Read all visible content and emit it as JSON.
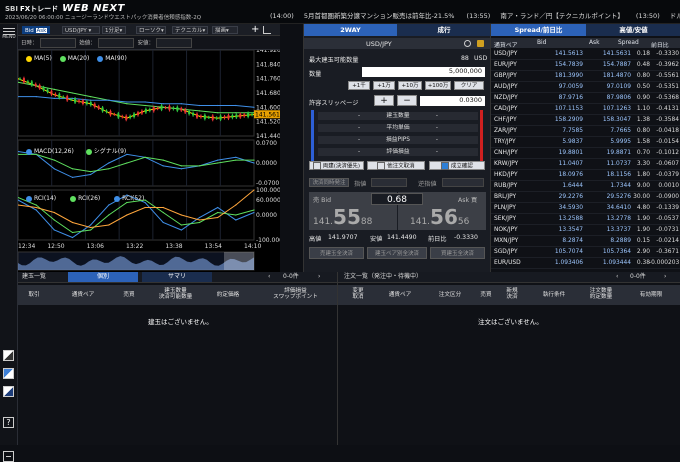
{
  "app": {
    "brand_prefix": "SBI",
    "brand_text": "FXトレード",
    "title": "WEB NEXT",
    "sub_header": "2023/06/20 06:00:00  ニュージーランドウエストパック消費者信頼感指数-2Q"
  },
  "ticker": [
    {
      "time": "(14:00)",
      "text": "5月首都圏新築分譲マンション販売は前年比-21.5%"
    },
    {
      "time": "(13:55)",
      "text": "南ア・ランド／円【テクニカルポイント】"
    },
    {
      "time": "(13:50)",
      "text": "ドル"
    }
  ],
  "menu": {
    "label": "MENU",
    "help_icon": "?"
  },
  "chart_toolbar": {
    "tab": "Bid",
    "tab_alt": "Ask",
    "pair": "USD/JPY",
    "interval": "1分足",
    "type": "ローソク",
    "technical": "テクニカル",
    "draw": "描画",
    "ohlc_label": "日時：",
    "open_label": "始値：",
    "close_label": "安値：",
    "high_label": "終値："
  },
  "chart_data": [
    {
      "type": "line",
      "title": "",
      "x": [
        "12:34",
        "12:50",
        "13:06",
        "13:22",
        "13:38",
        "13:54",
        "14:10"
      ],
      "ylim": [
        141.44,
        141.92
      ],
      "yticks": [
        "141.9200",
        "141.8400",
        "141.7600",
        "141.6800",
        "141.6000",
        "141.5200",
        "141.4400"
      ],
      "series": [
        {
          "name": "MA(5)",
          "color": "#ffd700",
          "values": [
            141.76,
            141.72,
            141.67,
            141.64,
            141.62,
            141.57,
            141.54,
            141.58,
            141.6,
            141.59,
            141.55,
            141.54,
            141.55,
            141.56
          ]
        },
        {
          "name": "MA(20)",
          "color": "#5fe05f",
          "values": [
            141.74,
            141.72,
            141.7,
            141.68,
            141.66,
            141.64,
            141.62,
            141.61,
            141.6,
            141.59,
            141.58,
            141.57,
            141.57,
            141.57
          ]
        },
        {
          "name": "MA(90)",
          "color": "#3f8fe8",
          "values": [
            141.66,
            141.66,
            141.65,
            141.65,
            141.64,
            141.64,
            141.63,
            141.63,
            141.62,
            141.62,
            141.61,
            141.61,
            141.61,
            141.6
          ]
        }
      ],
      "current_price": "141.5613"
    },
    {
      "type": "line",
      "yticks": [
        "0.0700",
        "0.0000",
        "-0.0700"
      ],
      "series": [
        {
          "name": "MACD(12,26)",
          "color": "#3f8fe8",
          "values": [
            0.04,
            0.03,
            -0.02,
            -0.05,
            -0.04,
            0.0,
            0.03,
            0.02,
            -0.01,
            -0.02,
            -0.01,
            0.01,
            0.02,
            0.0
          ]
        },
        {
          "name": "シグナル(9)",
          "color": "#5fe05f",
          "values": [
            0.03,
            0.03,
            0.01,
            -0.02,
            -0.03,
            -0.02,
            0.0,
            0.02,
            0.01,
            -0.01,
            -0.01,
            0.0,
            0.01,
            0.01
          ]
        }
      ]
    },
    {
      "type": "line",
      "yticks": [
        "100.0000",
        "60.0000",
        "0.0000",
        "-100.0000"
      ],
      "series": [
        {
          "name": "RCI(14)",
          "color": "#3f8fe8",
          "values": [
            60,
            20,
            -60,
            -90,
            -40,
            40,
            80,
            50,
            -30,
            -60,
            -10,
            30,
            -20,
            10
          ]
        },
        {
          "name": "RCI(26)",
          "color": "#5fe05f",
          "values": [
            70,
            40,
            -20,
            -70,
            -60,
            0,
            50,
            60,
            10,
            -40,
            -30,
            10,
            0,
            20
          ]
        },
        {
          "name": "RCI(52)",
          "color": "#ffa63c",
          "values": [
            40,
            30,
            10,
            -30,
            -50,
            -40,
            0,
            30,
            30,
            0,
            -20,
            -10,
            40,
            100
          ]
        }
      ]
    }
  ],
  "order_panel": {
    "tab_2way": "2WAY",
    "tab_order": "成行",
    "pair": "USD/JPY",
    "max_qty_label": "最大建玉可能数量",
    "max_qty_value": "88",
    "max_qty_unit": "USD",
    "qty_label": "数量",
    "qty_value": "5,000,000",
    "btn_1": "+1千",
    "btn_2": "+1万",
    "btn_3": "+10万",
    "btn_4": "+100万",
    "btn_clear": "クリア",
    "slippage_label": "許容スリッページ",
    "slippage_value": "0.0300",
    "rows": [
      "建玉数量",
      "平均単価",
      "損益PIPS",
      "評価損益"
    ],
    "chk_1": "両建(決済優先)",
    "chk_2": "他注文取消",
    "chk_3": "成立確認",
    "close_label": "決済同時発注",
    "close_sub": "指値",
    "close_sub2": "逆指値",
    "sell_label": "売 Bid",
    "sell_prefix": "141.",
    "sell_big": "55",
    "sell_small": "88",
    "spread": "0.68",
    "buy_label": "Ask 買",
    "buy_prefix": "141.",
    "buy_big": "56",
    "buy_small": "56",
    "high_label": "高値",
    "high_value": "141.9707",
    "low_label": "安値",
    "low_value": "141.4490",
    "prev_label": "前日比",
    "prev_value": "-0.3330",
    "bottom_1": "売建玉全決済",
    "bottom_2": "建玉ペア別全決済",
    "bottom_3": "買建玉全決済"
  },
  "rates": {
    "tab_1": "Spread/前日比",
    "tab_2": "高値/安値",
    "headers": [
      "通貨ペア",
      "Bid",
      "Ask",
      "Spread",
      "前日比"
    ],
    "rows": [
      [
        "USD/JPY",
        "141.5613",
        "141.5631",
        "0.18",
        "-0.3330"
      ],
      [
        "EUR/JPY",
        "154.7839",
        "154.7887",
        "0.48",
        "-0.3962"
      ],
      [
        "GBP/JPY",
        "181.3990",
        "181.4870",
        "0.80",
        "-0.5561"
      ],
      [
        "AUD/JPY",
        "97.0059",
        "97.0109",
        "0.50",
        "-0.5351"
      ],
      [
        "NZD/JPY",
        "87.9716",
        "87.9806",
        "0.90",
        "-0.5368"
      ],
      [
        "CAD/JPY",
        "107.1153",
        "107.1263",
        "1.10",
        "-0.4131"
      ],
      [
        "CHF/JPY",
        "158.2909",
        "158.3047",
        "1.38",
        "-0.3584"
      ],
      [
        "ZAR/JPY",
        "7.7585",
        "7.7665",
        "0.80",
        "-0.0418"
      ],
      [
        "TRY/JPY",
        "5.9837",
        "5.9995",
        "1.58",
        "-0.0154"
      ],
      [
        "CNH/JPY",
        "19.8801",
        "19.8871",
        "0.70",
        "-0.1012"
      ],
      [
        "KRW/JPY",
        "11.0407",
        "11.0737",
        "3.30",
        "-0.0607"
      ],
      [
        "HKD/JPY",
        "18.0976",
        "18.1156",
        "1.80",
        "-0.0379"
      ],
      [
        "RUB/JPY",
        "1.6444",
        "1.7344",
        "9.00",
        "0.0010"
      ],
      [
        "BRL/JPY",
        "29.2276",
        "29.5276",
        "30.00",
        "-0.0900"
      ],
      [
        "PLN/JPY",
        "34.5930",
        "34.6410",
        "4.80",
        "-0.1339"
      ],
      [
        "SEK/JPY",
        "13.2588",
        "13.2778",
        "1.90",
        "-0.0537"
      ],
      [
        "NOK/JPY",
        "13.3547",
        "13.3737",
        "1.90",
        "-0.0731"
      ],
      [
        "MXN/JPY",
        "8.2874",
        "8.2889",
        "0.15",
        "-0.0214"
      ],
      [
        "SGD/JPY",
        "105.7074",
        "105.7364",
        "2.90",
        "-0.3671"
      ],
      [
        "EUR/USD",
        "1.093406",
        "1.093444",
        "0.38",
        "-0.000203"
      ]
    ]
  },
  "positions": {
    "tab_1": "建玉一覧",
    "tab_2": "個別",
    "tab_3": "サマリ",
    "count": "0-0件",
    "cols": [
      "取引",
      "通貨ペア",
      "売買",
      "建玉数量\n決済可能数量",
      "約定価格",
      "評価損益\nスワップポイント"
    ],
    "empty": "建玉はございません。"
  },
  "orders": {
    "tab_1": "注文一覧（発注中・待機中）",
    "count": "0-0件",
    "cols": [
      "変更\n取消",
      "通貨ペア",
      "注文区分",
      "売買",
      "新規\n決済",
      "執行条件",
      "注文数量\n約定数量",
      "有効期限"
    ],
    "empty": "注文はございません。"
  }
}
